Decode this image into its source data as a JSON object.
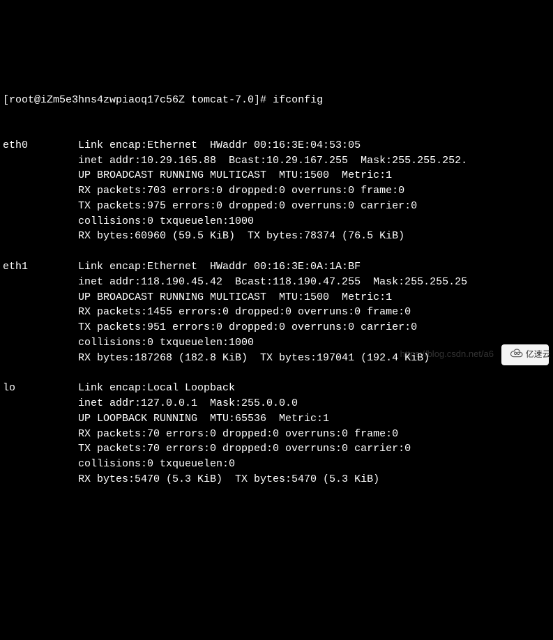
{
  "prompt": {
    "prefix": "[root@iZm5e3hns4zwpiaoq17c56Z tomcat-7.0]# ",
    "command": "ifconfig"
  },
  "interfaces": [
    {
      "name": "eth0",
      "lines": [
        "Link encap:Ethernet  HWaddr 00:16:3E:04:53:05",
        "inet addr:10.29.165.88  Bcast:10.29.167.255  Mask:255.255.252.",
        "UP BROADCAST RUNNING MULTICAST  MTU:1500  Metric:1",
        "RX packets:703 errors:0 dropped:0 overruns:0 frame:0",
        "TX packets:975 errors:0 dropped:0 overruns:0 carrier:0",
        "collisions:0 txqueuelen:1000",
        "RX bytes:60960 (59.5 KiB)  TX bytes:78374 (76.5 KiB)"
      ]
    },
    {
      "name": "eth1",
      "lines": [
        "Link encap:Ethernet  HWaddr 00:16:3E:0A:1A:BF",
        "inet addr:118.190.45.42  Bcast:118.190.47.255  Mask:255.255.25",
        "UP BROADCAST RUNNING MULTICAST  MTU:1500  Metric:1",
        "RX packets:1455 errors:0 dropped:0 overruns:0 frame:0",
        "TX packets:951 errors:0 dropped:0 overruns:0 carrier:0",
        "collisions:0 txqueuelen:1000",
        "RX bytes:187268 (182.8 KiB)  TX bytes:197041 (192.4 KiB)"
      ]
    },
    {
      "name": "lo",
      "lines": [
        "Link encap:Local Loopback",
        "inet addr:127.0.0.1  Mask:255.0.0.0",
        "UP LOOPBACK RUNNING  MTU:65536  Metric:1",
        "RX packets:70 errors:0 dropped:0 overruns:0 frame:0",
        "TX packets:70 errors:0 dropped:0 overruns:0 carrier:0",
        "collisions:0 txqueuelen:0",
        "RX bytes:5470 (5.3 KiB)  TX bytes:5470 (5.3 KiB)"
      ]
    }
  ],
  "watermark": {
    "text": "亿速云",
    "url": "https://blog.csdn.net/a6"
  }
}
